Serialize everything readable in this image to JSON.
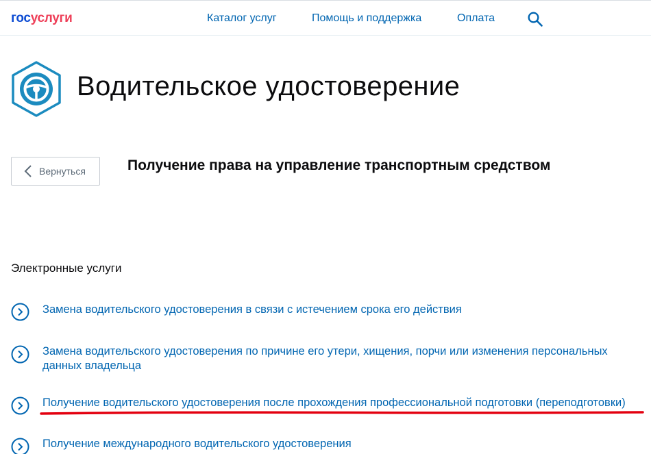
{
  "header": {
    "logo_part1": "гос",
    "logo_part2": "услуги",
    "nav": [
      {
        "label": "Каталог услуг"
      },
      {
        "label": "Помощь и поддержка"
      },
      {
        "label": "Оплата"
      }
    ],
    "icons": {
      "search": "search-icon"
    }
  },
  "page": {
    "title": "Водительское удостоверение",
    "icon": "steering-wheel-icon",
    "back_label": "Вернуться",
    "subtitle": "Получение права на управление транспортным средством"
  },
  "services": {
    "heading": "Электронные услуги",
    "items": [
      {
        "label": "Замена водительского удостоверения в связи с истечением срока его действия"
      },
      {
        "label": "Замена водительского удостоверения по причине его утери, хищения, порчи или изменения персональных данных владельца"
      },
      {
        "label": "Получение водительского удостоверения после прохождения профессиональной подготовки (переподготовки)",
        "highlighted": true
      },
      {
        "label": "Получение международного водительского удостоверения"
      }
    ]
  },
  "colors": {
    "link": "#0065b1",
    "logo_blue": "#0d4cd3",
    "logo_red": "#ee3f58",
    "highlight": "#e3000f",
    "icon_teal": "#1b8bbf"
  }
}
